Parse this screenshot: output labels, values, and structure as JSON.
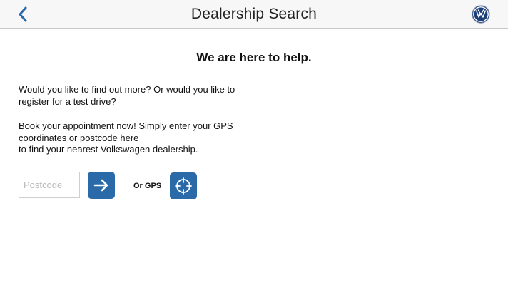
{
  "navbar": {
    "title": "Dealership Search",
    "back_icon": "chevron-left-icon",
    "logo_icon": "vw-logo-icon",
    "accent_color": "#2a6aa8"
  },
  "content": {
    "headline": "We are here to help.",
    "paragraph_1_line_1": "Would you like to find out more? Or would you like to",
    "paragraph_1_line_2": "register for a test drive?",
    "paragraph_2_line_1": "Book your appointment now! Simply enter your GPS",
    "paragraph_2_line_2": "coordinates or postcode here",
    "paragraph_2_line_3": "to find your nearest Volkswagen dealership."
  },
  "search": {
    "postcode_placeholder": "Postcode",
    "postcode_value": "",
    "go_icon": "arrow-right-icon",
    "or_label": "Or GPS",
    "gps_icon": "crosshair-icon"
  }
}
